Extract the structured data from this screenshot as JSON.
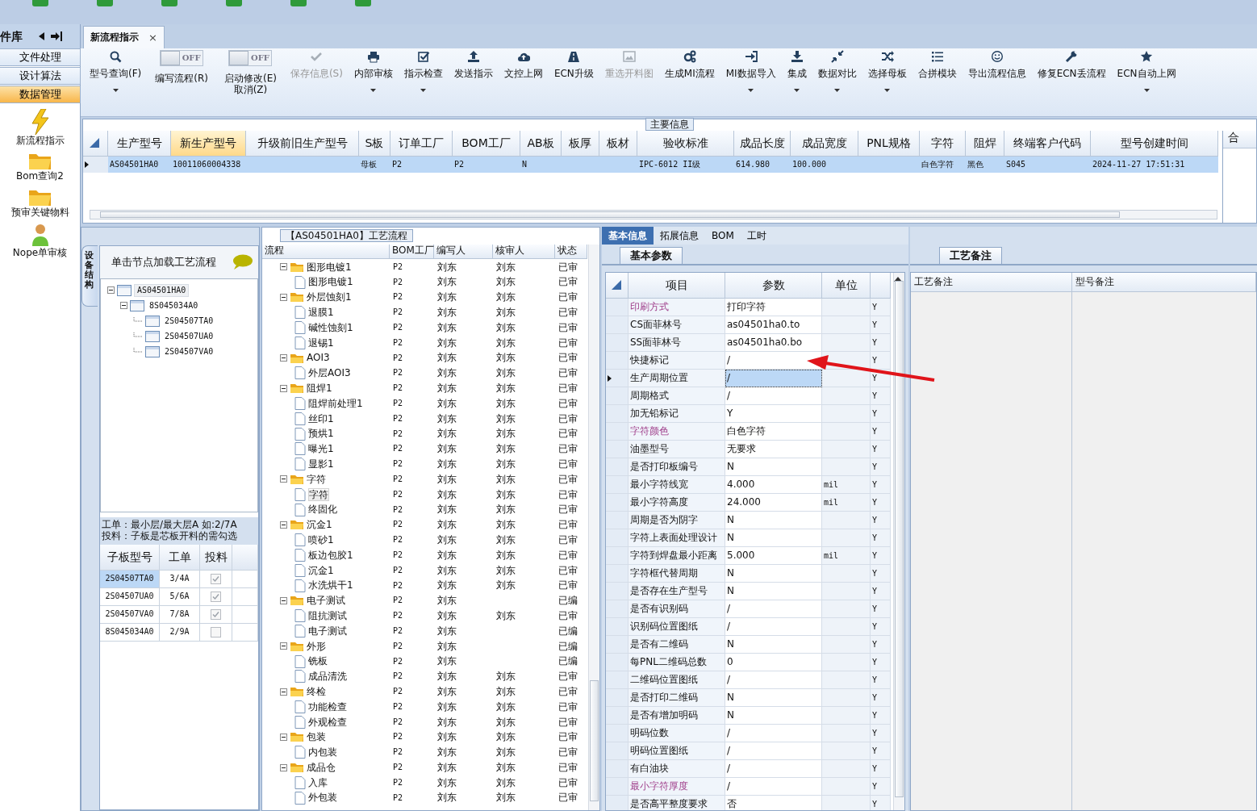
{
  "sidebar": {
    "title": "件库",
    "items": [
      {
        "label": "文件处理",
        "selected": false
      },
      {
        "label": "设计算法",
        "selected": false
      },
      {
        "label": "数据管理",
        "selected": true
      }
    ],
    "launchers": [
      {
        "label": "新流程指示",
        "kind": "lightning"
      },
      {
        "label": "Bom查询2",
        "kind": "folder"
      },
      {
        "label": "预审关键物料",
        "kind": "folder"
      },
      {
        "label": "Nope单审核",
        "kind": "person"
      }
    ]
  },
  "document_tabs": [
    {
      "label": "新流程指示",
      "selected": true,
      "close": "×"
    }
  ],
  "ribbon": [
    {
      "kind": "button",
      "label": "型号查询(F)",
      "dropdown": true,
      "disabled": false
    },
    {
      "kind": "toggle",
      "state_text": "OFF",
      "on": false,
      "label": "编写流程(R)"
    },
    {
      "kind": "toggle",
      "state_text": "OFF",
      "on": false,
      "label": "启动修改(E)",
      "sublabel": "取消(Z)"
    },
    {
      "kind": "button",
      "label": "保存信息(S)",
      "dropdown": false,
      "disabled": true
    },
    {
      "kind": "button",
      "label": "内部审核",
      "dropdown": true,
      "disabled": false
    },
    {
      "kind": "button",
      "label": "指示检查",
      "dropdown": true,
      "disabled": false
    },
    {
      "kind": "button",
      "label": "发送指示",
      "dropdown": false,
      "disabled": false
    },
    {
      "kind": "button",
      "label": "文控上网",
      "dropdown": false,
      "disabled": false
    },
    {
      "kind": "button",
      "label": "ECN升级",
      "dropdown": false,
      "disabled": false
    },
    {
      "kind": "button",
      "label": "重选开料图",
      "dropdown": false,
      "disabled": true
    },
    {
      "kind": "button",
      "label": "生成MI流程",
      "dropdown": false,
      "disabled": false
    },
    {
      "kind": "button",
      "label": "MI数据导入",
      "dropdown": true,
      "disabled": false
    },
    {
      "kind": "button",
      "label": "集成",
      "dropdown": true,
      "disabled": false
    },
    {
      "kind": "button",
      "label": "数据对比",
      "dropdown": true,
      "disabled": false
    },
    {
      "kind": "button",
      "label": "选择母板",
      "dropdown": true,
      "disabled": false
    },
    {
      "kind": "button",
      "label": "合拼模块",
      "dropdown": false,
      "disabled": false
    },
    {
      "kind": "button",
      "label": "导出流程信息",
      "dropdown": false,
      "disabled": false
    },
    {
      "kind": "button",
      "label": "修复ECN丢流程",
      "dropdown": false,
      "disabled": false
    },
    {
      "kind": "button",
      "label": "ECN自动上网",
      "dropdown": true,
      "disabled": false
    }
  ],
  "main_info": {
    "title": "主要信息",
    "next_panel_header": "合",
    "table": {
      "columns": [
        {
          "label": "生产型号",
          "highlighted": false
        },
        {
          "label": "新生产型号",
          "highlighted": true
        },
        {
          "label": "升级前旧生产型号",
          "highlighted": false
        },
        {
          "label": "S板",
          "highlighted": false
        },
        {
          "label": "订单工厂",
          "highlighted": false
        },
        {
          "label": "BOM工厂",
          "highlighted": false
        },
        {
          "label": "AB板",
          "highlighted": false
        },
        {
          "label": "板厚",
          "highlighted": false
        },
        {
          "label": "板材",
          "highlighted": false
        },
        {
          "label": "验收标准",
          "highlighted": false
        },
        {
          "label": "成品长度",
          "highlighted": false
        },
        {
          "label": "成品宽度",
          "highlighted": false
        },
        {
          "label": "PNL规格",
          "highlighted": false
        },
        {
          "label": "字符",
          "highlighted": false
        },
        {
          "label": "阻焊",
          "highlighted": false
        },
        {
          "label": "终端客户代码",
          "highlighted": false
        },
        {
          "label": "型号创建时间",
          "highlighted": false
        }
      ],
      "rows": [
        {
          "selected": true,
          "cells": [
            "AS04501HA0",
            "10011060004338",
            "",
            "母板",
            "P2",
            "P2",
            "N",
            "",
            "",
            "IPC-6012 II级",
            "614.980",
            "100.000",
            "",
            "白色字符",
            "黑色",
            "S045",
            "2024-11-27 17:51:31"
          ]
        }
      ]
    }
  },
  "structure_panel": {
    "side_tab": "设备结构",
    "header": "单击节点加载工艺流程",
    "tree": [
      {
        "label": "AS04501HA0",
        "selected": true,
        "expanded": true,
        "children": [
          {
            "label": "8S045034A0",
            "selected": false,
            "expanded": true,
            "children": [
              {
                "label": "2S04507TA0",
                "selected": false
              },
              {
                "label": "2S04507UA0",
                "selected": false
              },
              {
                "label": "2S04507VA0",
                "selected": false
              }
            ]
          }
        ]
      }
    ],
    "notes": [
      "工单：最小层/最大层A 如:2/7A",
      "投料：子板是芯板开料的需勾选"
    ],
    "subboard_table": {
      "columns": [
        "子板型号",
        "工单",
        "投料"
      ],
      "rows": [
        {
          "model": "2S04507TA0",
          "order": "3/4A",
          "checked": true,
          "selected": true
        },
        {
          "model": "2S04507UA0",
          "order": "5/6A",
          "checked": true,
          "selected": false
        },
        {
          "model": "2S04507VA0",
          "order": "7/8A",
          "checked": true,
          "selected": false
        },
        {
          "model": "8S045034A0",
          "order": "2/9A",
          "checked": false,
          "selected": false
        }
      ]
    }
  },
  "process_panel": {
    "title": "【AS04501HA0】工艺流程",
    "columns": [
      "流程",
      "BOM工厂",
      "编写人",
      "核审人",
      "状态"
    ],
    "rows": [
      {
        "kind": "folder",
        "name": "图形电镀1",
        "bom": "P2",
        "writer": "刘东",
        "reviewer": "刘东",
        "status": "已审",
        "expanded": true,
        "selected": false,
        "children": [
          {
            "kind": "step",
            "name": "图形电镀1",
            "bom": "P2",
            "writer": "刘东",
            "reviewer": "刘东",
            "status": "已审",
            "selected": false
          }
        ]
      },
      {
        "kind": "folder",
        "name": "外层蚀刻1",
        "bom": "P2",
        "writer": "刘东",
        "reviewer": "刘东",
        "status": "已审",
        "expanded": true,
        "selected": false,
        "children": [
          {
            "kind": "step",
            "name": "退膜1",
            "bom": "P2",
            "writer": "刘东",
            "reviewer": "刘东",
            "status": "已审",
            "selected": false
          },
          {
            "kind": "step",
            "name": "碱性蚀刻1",
            "bom": "P2",
            "writer": "刘东",
            "reviewer": "刘东",
            "status": "已审",
            "selected": false
          },
          {
            "kind": "step",
            "name": "退锡1",
            "bom": "P2",
            "writer": "刘东",
            "reviewer": "刘东",
            "status": "已审",
            "selected": false
          }
        ]
      },
      {
        "kind": "folder",
        "name": "AOI3",
        "bom": "P2",
        "writer": "刘东",
        "reviewer": "刘东",
        "status": "已审",
        "expanded": true,
        "selected": false,
        "children": [
          {
            "kind": "step",
            "name": "外层AOI3",
            "bom": "P2",
            "writer": "刘东",
            "reviewer": "刘东",
            "status": "已审",
            "selected": false
          }
        ]
      },
      {
        "kind": "folder",
        "name": "阻焊1",
        "bom": "P2",
        "writer": "刘东",
        "reviewer": "刘东",
        "status": "已审",
        "expanded": true,
        "selected": false,
        "children": [
          {
            "kind": "step",
            "name": "阻焊前处理1",
            "bom": "P2",
            "writer": "刘东",
            "reviewer": "刘东",
            "status": "已审",
            "selected": false
          },
          {
            "kind": "step",
            "name": "丝印1",
            "bom": "P2",
            "writer": "刘东",
            "reviewer": "刘东",
            "status": "已审",
            "selected": false
          },
          {
            "kind": "step",
            "name": "预烘1",
            "bom": "P2",
            "writer": "刘东",
            "reviewer": "刘东",
            "status": "已审",
            "selected": false
          },
          {
            "kind": "step",
            "name": "曝光1",
            "bom": "P2",
            "writer": "刘东",
            "reviewer": "刘东",
            "status": "已审",
            "selected": false
          },
          {
            "kind": "step",
            "name": "显影1",
            "bom": "P2",
            "writer": "刘东",
            "reviewer": "刘东",
            "status": "已审",
            "selected": false
          }
        ]
      },
      {
        "kind": "folder",
        "name": "字符",
        "bom": "P2",
        "writer": "刘东",
        "reviewer": "刘东",
        "status": "已审",
        "expanded": true,
        "selected": false,
        "children": [
          {
            "kind": "step",
            "name": "字符",
            "bom": "P2",
            "writer": "刘东",
            "reviewer": "刘东",
            "status": "已审",
            "selected": true
          },
          {
            "kind": "step",
            "name": "终固化",
            "bom": "P2",
            "writer": "刘东",
            "reviewer": "刘东",
            "status": "已审",
            "selected": false
          }
        ]
      },
      {
        "kind": "folder",
        "name": "沉金1",
        "bom": "P2",
        "writer": "刘东",
        "reviewer": "刘东",
        "status": "已审",
        "expanded": true,
        "selected": false,
        "children": [
          {
            "kind": "step",
            "name": "喷砂1",
            "bom": "P2",
            "writer": "刘东",
            "reviewer": "刘东",
            "status": "已审",
            "selected": false
          },
          {
            "kind": "step",
            "name": "板边包胶1",
            "bom": "P2",
            "writer": "刘东",
            "reviewer": "刘东",
            "status": "已审",
            "selected": false
          },
          {
            "kind": "step",
            "name": "沉金1",
            "bom": "P2",
            "writer": "刘东",
            "reviewer": "刘东",
            "status": "已审",
            "selected": false
          },
          {
            "kind": "step",
            "name": "水洗烘干1",
            "bom": "P2",
            "writer": "刘东",
            "reviewer": "刘东",
            "status": "已审",
            "selected": false
          }
        ]
      },
      {
        "kind": "folder",
        "name": "电子测试",
        "bom": "P2",
        "writer": "刘东",
        "status": "已编",
        "expanded": true,
        "selected": false,
        "children": [
          {
            "kind": "step",
            "name": "阻抗测试",
            "bom": "P2",
            "writer": "刘东",
            "reviewer": "刘东",
            "status": "已审",
            "selected": false
          },
          {
            "kind": "step",
            "name": "电子测试",
            "bom": "P2",
            "writer": "刘东",
            "status": "已编",
            "selected": false
          }
        ]
      },
      {
        "kind": "folder",
        "name": "外形",
        "bom": "P2",
        "writer": "刘东",
        "status": "已编",
        "expanded": true,
        "selected": false,
        "children": [
          {
            "kind": "step",
            "name": "铣板",
            "bom": "P2",
            "writer": "刘东",
            "status": "已编",
            "selected": false
          },
          {
            "kind": "step",
            "name": "成品清洗",
            "bom": "P2",
            "writer": "刘东",
            "reviewer": "刘东",
            "status": "已审",
            "selected": false
          }
        ]
      },
      {
        "kind": "folder",
        "name": "终检",
        "bom": "P2",
        "writer": "刘东",
        "reviewer": "刘东",
        "status": "已审",
        "expanded": true,
        "selected": false,
        "children": [
          {
            "kind": "step",
            "name": "功能检查",
            "bom": "P2",
            "writer": "刘东",
            "reviewer": "刘东",
            "status": "已审",
            "selected": false
          },
          {
            "kind": "step",
            "name": "外观检查",
            "bom": "P2",
            "writer": "刘东",
            "reviewer": "刘东",
            "status": "已审",
            "selected": false
          }
        ]
      },
      {
        "kind": "folder",
        "name": "包装",
        "bom": "P2",
        "writer": "刘东",
        "reviewer": "刘东",
        "status": "已审",
        "expanded": true,
        "selected": false,
        "children": [
          {
            "kind": "step",
            "name": "内包装",
            "bom": "P2",
            "writer": "刘东",
            "reviewer": "刘东",
            "status": "已审",
            "selected": false
          }
        ]
      },
      {
        "kind": "folder",
        "name": "成品仓",
        "bom": "P2",
        "writer": "刘东",
        "reviewer": "刘东",
        "status": "已审",
        "expanded": true,
        "selected": false,
        "children": [
          {
            "kind": "step",
            "name": "入库",
            "bom": "P2",
            "writer": "刘东",
            "reviewer": "刘东",
            "status": "已审",
            "selected": false
          },
          {
            "kind": "step",
            "name": "外包装",
            "bom": "P2",
            "writer": "刘东",
            "reviewer": "刘东",
            "status": "已审",
            "selected": false
          }
        ]
      }
    ]
  },
  "details": {
    "tabs": [
      {
        "label": "基本信息",
        "selected": true
      },
      {
        "label": "拓展信息",
        "selected": false
      },
      {
        "label": "BOM",
        "selected": false
      },
      {
        "label": "工时",
        "selected": false
      }
    ],
    "subtab": "基本参数",
    "columns": [
      "项目",
      "参数",
      "单位"
    ],
    "rows": [
      {
        "item": "印刷方式",
        "value": "打印字符",
        "unit": "",
        "flag": "Y",
        "selected": false,
        "highlighted": true
      },
      {
        "item": "CS面菲林号",
        "value": "as04501ha0.to",
        "unit": "",
        "flag": "Y",
        "selected": false,
        "highlighted": false
      },
      {
        "item": "SS面菲林号",
        "value": "as04501ha0.bo",
        "unit": "",
        "flag": "Y",
        "selected": false,
        "highlighted": false
      },
      {
        "item": "快捷标记",
        "value": "/",
        "unit": "",
        "flag": "Y",
        "selected": false,
        "highlighted": false
      },
      {
        "item": "生产周期位置",
        "value": "/",
        "unit": "",
        "flag": "Y",
        "selected": true,
        "highlighted": false
      },
      {
        "item": "周期格式",
        "value": "/",
        "unit": "",
        "flag": "Y",
        "selected": false,
        "highlighted": false
      },
      {
        "item": "加无铅标记",
        "value": "Y",
        "unit": "",
        "flag": "Y",
        "selected": false,
        "highlighted": false
      },
      {
        "item": "字符颜色",
        "value": "白色字符",
        "unit": "",
        "flag": "Y",
        "selected": false,
        "highlighted": true
      },
      {
        "item": "油墨型号",
        "value": "无要求",
        "unit": "",
        "flag": "Y",
        "selected": false,
        "highlighted": false
      },
      {
        "item": "是否打印板编号",
        "value": "N",
        "unit": "",
        "flag": "Y",
        "selected": false,
        "highlighted": false
      },
      {
        "item": "最小字符线宽",
        "value": "4.000",
        "unit": "mil",
        "flag": "Y",
        "selected": false,
        "highlighted": false
      },
      {
        "item": "最小字符高度",
        "value": "24.000",
        "unit": "mil",
        "flag": "Y",
        "selected": false,
        "highlighted": false
      },
      {
        "item": "周期是否为阴字",
        "value": "N",
        "unit": "",
        "flag": "Y",
        "selected": false,
        "highlighted": false
      },
      {
        "item": "字符上表面处理设计",
        "value": "N",
        "unit": "",
        "flag": "Y",
        "selected": false,
        "highlighted": false
      },
      {
        "item": "字符到焊盘最小距离",
        "value": "5.000",
        "unit": "mil",
        "flag": "Y",
        "selected": false,
        "highlighted": false
      },
      {
        "item": "字符框代替周期",
        "value": "N",
        "unit": "",
        "flag": "Y",
        "selected": false,
        "highlighted": false
      },
      {
        "item": "是否存在生产型号",
        "value": "N",
        "unit": "",
        "flag": "Y",
        "selected": false,
        "highlighted": false
      },
      {
        "item": "是否有识别码",
        "value": "/",
        "unit": "",
        "flag": "Y",
        "selected": false,
        "highlighted": false
      },
      {
        "item": "识别码位置图纸",
        "value": "/",
        "unit": "",
        "flag": "Y",
        "selected": false,
        "highlighted": false
      },
      {
        "item": "是否有二维码",
        "value": "N",
        "unit": "",
        "flag": "Y",
        "selected": false,
        "highlighted": false
      },
      {
        "item": "每PNL二维码总数",
        "value": "0",
        "unit": "",
        "flag": "Y",
        "selected": false,
        "highlighted": false
      },
      {
        "item": "二维码位置图纸",
        "value": "/",
        "unit": "",
        "flag": "Y",
        "selected": false,
        "highlighted": false
      },
      {
        "item": "是否打印二维码",
        "value": "N",
        "unit": "",
        "flag": "Y",
        "selected": false,
        "highlighted": false
      },
      {
        "item": "是否有增加明码",
        "value": "N",
        "unit": "",
        "flag": "Y",
        "selected": false,
        "highlighted": false
      },
      {
        "item": "明码位数",
        "value": "/",
        "unit": "",
        "flag": "Y",
        "selected": false,
        "highlighted": false
      },
      {
        "item": "明码位置图纸",
        "value": "/",
        "unit": "",
        "flag": "Y",
        "selected": false,
        "highlighted": false
      },
      {
        "item": "有白油块",
        "value": "/",
        "unit": "",
        "flag": "Y",
        "selected": false,
        "highlighted": false
      },
      {
        "item": "最小字符厚度",
        "value": "/",
        "unit": "",
        "flag": "Y",
        "selected": false,
        "highlighted": true
      },
      {
        "item": "是否高平整度要求",
        "value": "否",
        "unit": "",
        "flag": "Y",
        "selected": false,
        "highlighted": false
      }
    ]
  },
  "remarks": {
    "tab": "工艺备注",
    "columns": [
      "工艺备注",
      "型号备注"
    ]
  }
}
